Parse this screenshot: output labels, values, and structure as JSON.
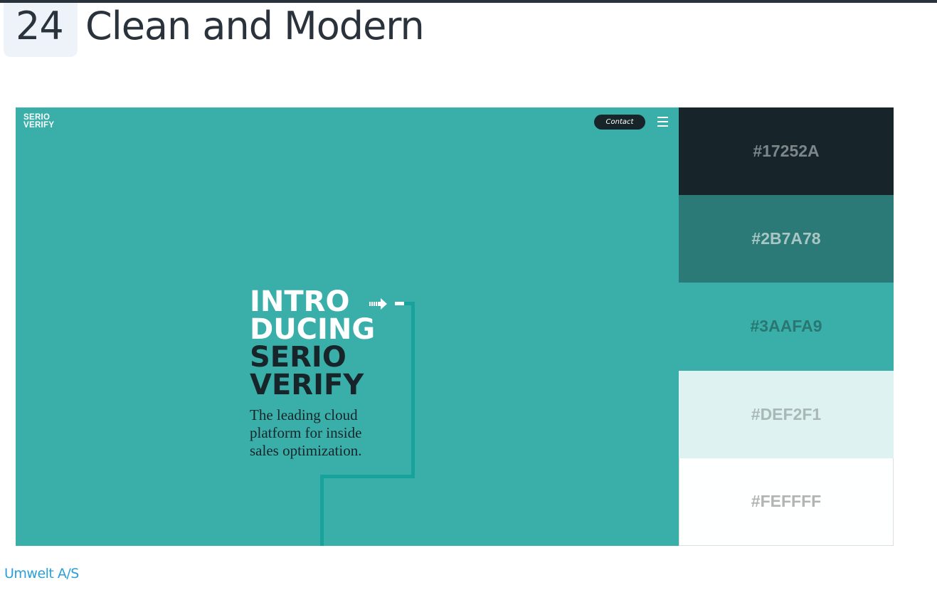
{
  "header": {
    "number": "24",
    "title": "Clean and Modern"
  },
  "preview": {
    "logo": [
      "SERIO",
      "VERIFY"
    ],
    "contact_label": "Contact",
    "menu_icon": "hamburger-menu-icon",
    "arrow_icon": "dashed-arrow-icon",
    "headline_light": [
      "INTRO",
      "DUCING"
    ],
    "headline_dark": [
      "SERIO",
      "VERIFY"
    ],
    "tagline": [
      "The leading cloud",
      "platform for inside",
      "sales optimization."
    ],
    "colors": {
      "hero_bg": "#3AAFA9",
      "button_bg": "#17252A",
      "connector": "#17A39B"
    }
  },
  "palette": [
    {
      "hex": "#17252A",
      "text_color": "#7d878a"
    },
    {
      "hex": "#2B7A78",
      "text_color": "#a9c6c4"
    },
    {
      "hex": "#3AAFA9",
      "text_color": "#2a7671"
    },
    {
      "hex": "#DEF2F1",
      "text_color": "#a9b8b7"
    },
    {
      "hex": "#FEFFFF",
      "text_color": "#b3b3b3"
    }
  ],
  "footer": {
    "source_link": "Umwelt A/S"
  }
}
